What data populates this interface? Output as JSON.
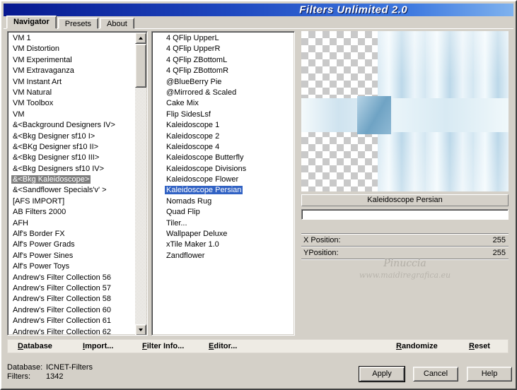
{
  "window": {
    "title": "Filters Unlimited 2.0"
  },
  "colors": {
    "window_bg": "#d4d0c8",
    "titlebar_start": "#07188f",
    "titlebar_end": "#7fb2ee",
    "selection_blue": "#3162c4",
    "selection_gray": "#808080"
  },
  "tabs": [
    {
      "label": "Navigator",
      "active": true
    },
    {
      "label": "Presets",
      "active": false
    },
    {
      "label": "About",
      "active": false
    }
  ],
  "categories": {
    "selected": "&<Bkg Kaleidoscope>",
    "items": [
      "VM 1",
      "VM Distortion",
      "VM Experimental",
      "VM Extravaganza",
      "VM Instant Art",
      "VM Natural",
      "VM Toolbox",
      "VM",
      "&<Background Designers IV>",
      "&<Bkg Designer sf10 I>",
      "&<BKg Designer sf10 II>",
      "&<Bkg Designer sf10 III>",
      "&<Bkg Designers sf10 IV>",
      "&<Bkg Kaleidoscope>",
      "&<Sandflower Specials'v' >",
      "[AFS IMPORT]",
      "AB Filters 2000",
      "AFH",
      "Alf's Border FX",
      "Alf's Power Grads",
      "Alf's Power Sines",
      "Alf's Power Toys",
      "Andrew's Filter Collection 56",
      "Andrew's Filter Collection 57",
      "Andrew's Filter Collection 58",
      "Andrew's Filter Collection 60",
      "Andrew's Filter Collection 61",
      "Andrew's Filter Collection 62"
    ]
  },
  "filters": {
    "selected": "Kaleidoscope Persian",
    "items": [
      "4 QFlip UpperL",
      "4 QFlip UpperR",
      "4 QFlip ZBottomL",
      "4 QFlip ZBottomR",
      "@BlueBerry Pie",
      "@Mirrored & Scaled",
      "Cake Mix",
      "Flip SidesLsf",
      "Kaleidoscope 1",
      "Kaleidoscope 2",
      "Kaleidoscope 4",
      "Kaleidoscope Butterfly",
      "Kaleidoscope Divisions",
      "Kaleidoscope Flower",
      "Kaleidoscope Persian",
      "Nomads Rug",
      "Quad Flip",
      "Tiler...",
      "Wallpaper Deluxe",
      "xTile Maker 1.0",
      "Zandflower"
    ]
  },
  "preview": {
    "caption": "Kaleidoscope Persian"
  },
  "params": [
    {
      "label": "X Position:",
      "value": "255"
    },
    {
      "label": "YPosition:",
      "value": "255"
    }
  ],
  "watermark": {
    "line1": "Pinuccia",
    "line2": "www.maidiregrafica.eu"
  },
  "toolbar": {
    "database": "Database",
    "import": "Import...",
    "filter_info": "Filter Info...",
    "editor": "Editor...",
    "randomize": "Randomize",
    "reset": "Reset"
  },
  "status": {
    "database_label": "Database:",
    "database_value": "ICNET-Filters",
    "filters_label": "Filters:",
    "filters_value": "1342"
  },
  "buttons": {
    "apply": "Apply",
    "cancel": "Cancel",
    "help": "Help"
  }
}
